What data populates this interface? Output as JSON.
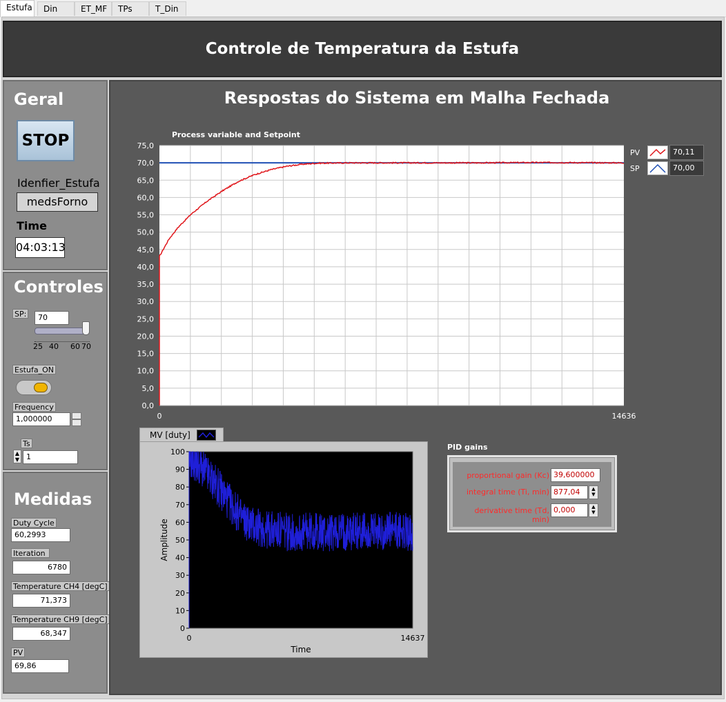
{
  "tabs": [
    {
      "label": "Estufa",
      "active": true
    },
    {
      "label": "Din"
    },
    {
      "label": "ET_MF"
    },
    {
      "label": "TPs"
    },
    {
      "label": "T_Din"
    }
  ],
  "header": {
    "title": "Controle de Temperatura da Estufa"
  },
  "geral": {
    "title": "Geral",
    "stop_label": "STOP",
    "ident_label": "Idenfier_Estufa",
    "ident_value": "medsForno",
    "time_label": "Time",
    "time_value": "04:03:13"
  },
  "controles": {
    "title": "Controles",
    "sp_label": "SP:",
    "sp_value": "70",
    "slider_ticks": [
      "25",
      "40",
      "60",
      "70"
    ],
    "slider_level": 70,
    "estufa_label": "Estufa_ON",
    "frequency_label": "Frequency",
    "frequency_value": "1,000000",
    "ts_label": "Ts",
    "ts_value": "1"
  },
  "medidas": {
    "title": "Medidas",
    "duty_label": "Duty Cycle",
    "duty_value": "60,2993",
    "iter_label": "Iteration",
    "iter_value": "6780",
    "ch4_label": "Temperature CH4 [degC]",
    "ch4_value": "71,373",
    "ch9_label": "Temperature CH9 [degC]",
    "ch9_value": "68,347",
    "pv_label": "PV",
    "pv_value": "69,86"
  },
  "main": {
    "title": "Respostas do Sistema em Malha Fechada"
  },
  "pid": {
    "title": "PID gains",
    "kc_label": "proportional gain (Kc)",
    "kc_value": "39,600000",
    "ti_label": "integral time (Ti, min)",
    "ti_value": "877,04",
    "td_label": "derivative time (Td, min)",
    "td_value": "0,000"
  },
  "colors": {
    "pv": "#e0161b",
    "sp": "#1f4fb4",
    "mv": "#1f1fd8",
    "accent_led": "#f0b400"
  },
  "chart_data": [
    {
      "type": "line",
      "title": "Process variable and Setpoint",
      "xlim": [
        0,
        14636
      ],
      "ylim": [
        0,
        75
      ],
      "yticks": [
        "0,0",
        "5,0",
        "10,0",
        "15,0",
        "20,0",
        "25,0",
        "30,0",
        "35,0",
        "40,0",
        "45,0",
        "50,0",
        "55,0",
        "60,0",
        "65,0",
        "70,0",
        "75,0"
      ],
      "xticks": [
        "0",
        "14636"
      ],
      "grid": true,
      "legend_position": "right",
      "series": [
        {
          "name": "PV",
          "legend_value": "70,11",
          "x": [
            0,
            300,
            600,
            1000,
            1500,
            2000,
            2500,
            3000,
            3500,
            4000,
            4500,
            5000,
            6000,
            8000,
            10000,
            12000,
            14636
          ],
          "values": [
            43.0,
            48.0,
            51.5,
            55.2,
            58.9,
            62.0,
            64.7,
            66.6,
            68.0,
            69.0,
            69.6,
            69.9,
            70.0,
            70.0,
            70.0,
            70.1,
            70.0
          ]
        },
        {
          "name": "SP",
          "legend_value": "70,00",
          "x": [
            0,
            14636
          ],
          "values": [
            70.0,
            70.0
          ]
        }
      ]
    },
    {
      "type": "line",
      "title": "MV [duty]",
      "xlabel": "Time",
      "ylabel": "Amplitude",
      "xlim": [
        0,
        14637
      ],
      "ylim": [
        0,
        100
      ],
      "yticks": [
        "0",
        "10",
        "20",
        "30",
        "40",
        "50",
        "60",
        "70",
        "80",
        "90",
        "100"
      ],
      "xticks": [
        "0",
        "14637"
      ],
      "grid": false,
      "series": [
        {
          "name": "MV [duty]",
          "x": [
            0,
            500,
            1000,
            1500,
            2000,
            2500,
            3000,
            3500,
            4000,
            4500,
            5000,
            6000,
            7000,
            8000,
            9000,
            10000,
            11000,
            12000,
            13000,
            14000,
            14637
          ],
          "values": [
            96,
            93,
            89,
            84,
            79,
            73,
            67,
            62,
            59,
            57,
            56,
            55,
            54,
            55,
            54,
            55,
            55,
            54,
            55,
            55,
            54
          ]
        }
      ]
    }
  ]
}
